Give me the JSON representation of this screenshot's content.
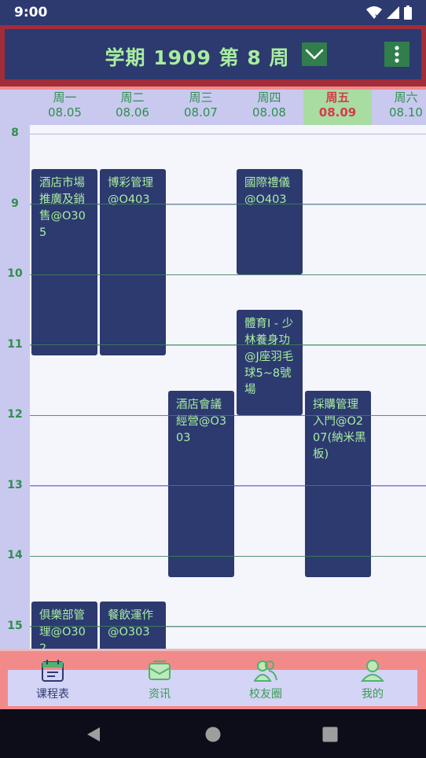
{
  "status": {
    "time": "9:00"
  },
  "header": {
    "title_prefix": "学期",
    "term": "1909",
    "title_week_word": "第",
    "week": "8",
    "title_suffix": "周"
  },
  "days": [
    {
      "name": "周一",
      "date": "08.05",
      "today": false
    },
    {
      "name": "周二",
      "date": "08.06",
      "today": false
    },
    {
      "name": "周三",
      "date": "08.07",
      "today": false
    },
    {
      "name": "周四",
      "date": "08.08",
      "today": false
    },
    {
      "name": "周五",
      "date": "08.09",
      "today": true
    },
    {
      "name": "周六",
      "date": "08.10",
      "today": false
    }
  ],
  "hours": [
    "8",
    "9",
    "10",
    "11",
    "12",
    "13",
    "14",
    "15"
  ],
  "courses": [
    {
      "day": 1,
      "start": 8.5,
      "end": 11.15,
      "text": "酒店市場推廣及銷售@O305"
    },
    {
      "day": 2,
      "start": 8.5,
      "end": 11.15,
      "text": "博彩管理@O403"
    },
    {
      "day": 4,
      "start": 8.5,
      "end": 10.0,
      "text": "國際禮儀@O403"
    },
    {
      "day": 4,
      "start": 10.5,
      "end": 12.0,
      "text": "體育I - 少林養身功@J座羽毛球5~8號場"
    },
    {
      "day": 3,
      "start": 11.65,
      "end": 14.3,
      "text": "酒店會議經營@O303"
    },
    {
      "day": 5,
      "start": 11.65,
      "end": 14.3,
      "text": "採購管理入門@O207(納米黑板)"
    },
    {
      "day": 1,
      "start": 14.65,
      "end": 16.0,
      "text": "俱樂部管理@O302"
    },
    {
      "day": 2,
      "start": 14.65,
      "end": 16.0,
      "text": "餐飲運作@O303"
    }
  ],
  "nav": [
    {
      "label": "课程表",
      "icon": "calendar-icon",
      "active": true
    },
    {
      "label": "资讯",
      "icon": "mail-icon",
      "active": false
    },
    {
      "label": "校友圈",
      "icon": "people-icon",
      "active": false
    },
    {
      "label": "我的",
      "icon": "person-icon",
      "active": false
    }
  ],
  "colors": {
    "primary": "#2c3a70",
    "accent_green": "#a9eda0",
    "header_frame": "#a22d3a",
    "today_bg": "#a8dca1",
    "today_text": "#d73a4d",
    "bottom_frame": "#f38a8a"
  }
}
